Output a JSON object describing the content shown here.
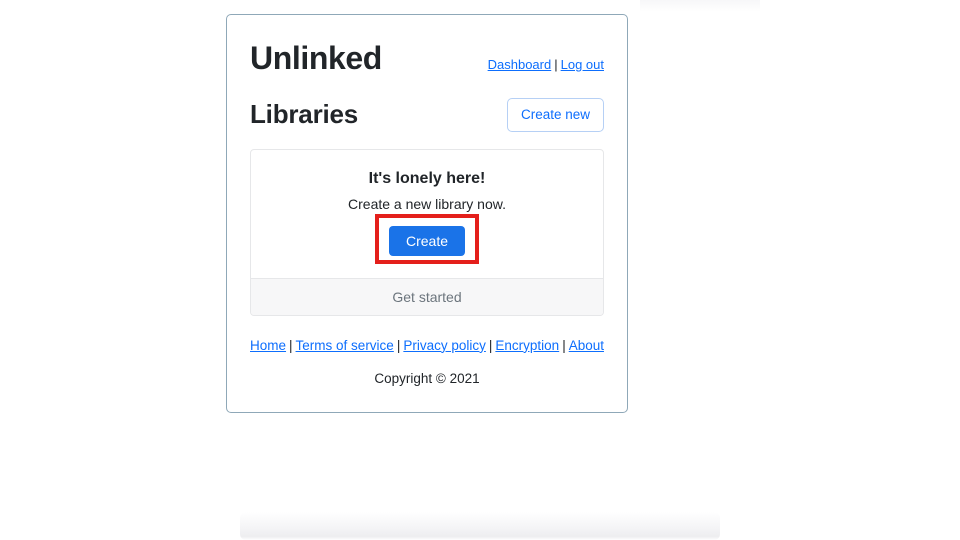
{
  "header": {
    "app_title": "Unlinked",
    "links": [
      {
        "label": "Dashboard",
        "name": "dashboard-link"
      },
      {
        "label": "Log out",
        "name": "log-out-link"
      }
    ],
    "separator": "|"
  },
  "section": {
    "title": "Libraries",
    "create_new_label": "Create new"
  },
  "card": {
    "heading": "It's lonely here!",
    "text": "Create a new library now.",
    "create_button_label": "Create",
    "footer_label": "Get started"
  },
  "footer": {
    "links": [
      {
        "label": "Home"
      },
      {
        "label": "Terms of service"
      },
      {
        "label": "Privacy policy"
      },
      {
        "label": "Encryption"
      },
      {
        "label": "About"
      }
    ],
    "separator": "|",
    "copyright": "Copyright © 2021"
  },
  "colors": {
    "link_blue": "#0d6efd",
    "primary_button": "#1a73e8",
    "annotation_red": "#e41f1b",
    "container_border": "#8fa8b8",
    "card_footer_bg": "#f7f7f8",
    "muted_text": "#6c757d",
    "heading_text": "#212529"
  }
}
